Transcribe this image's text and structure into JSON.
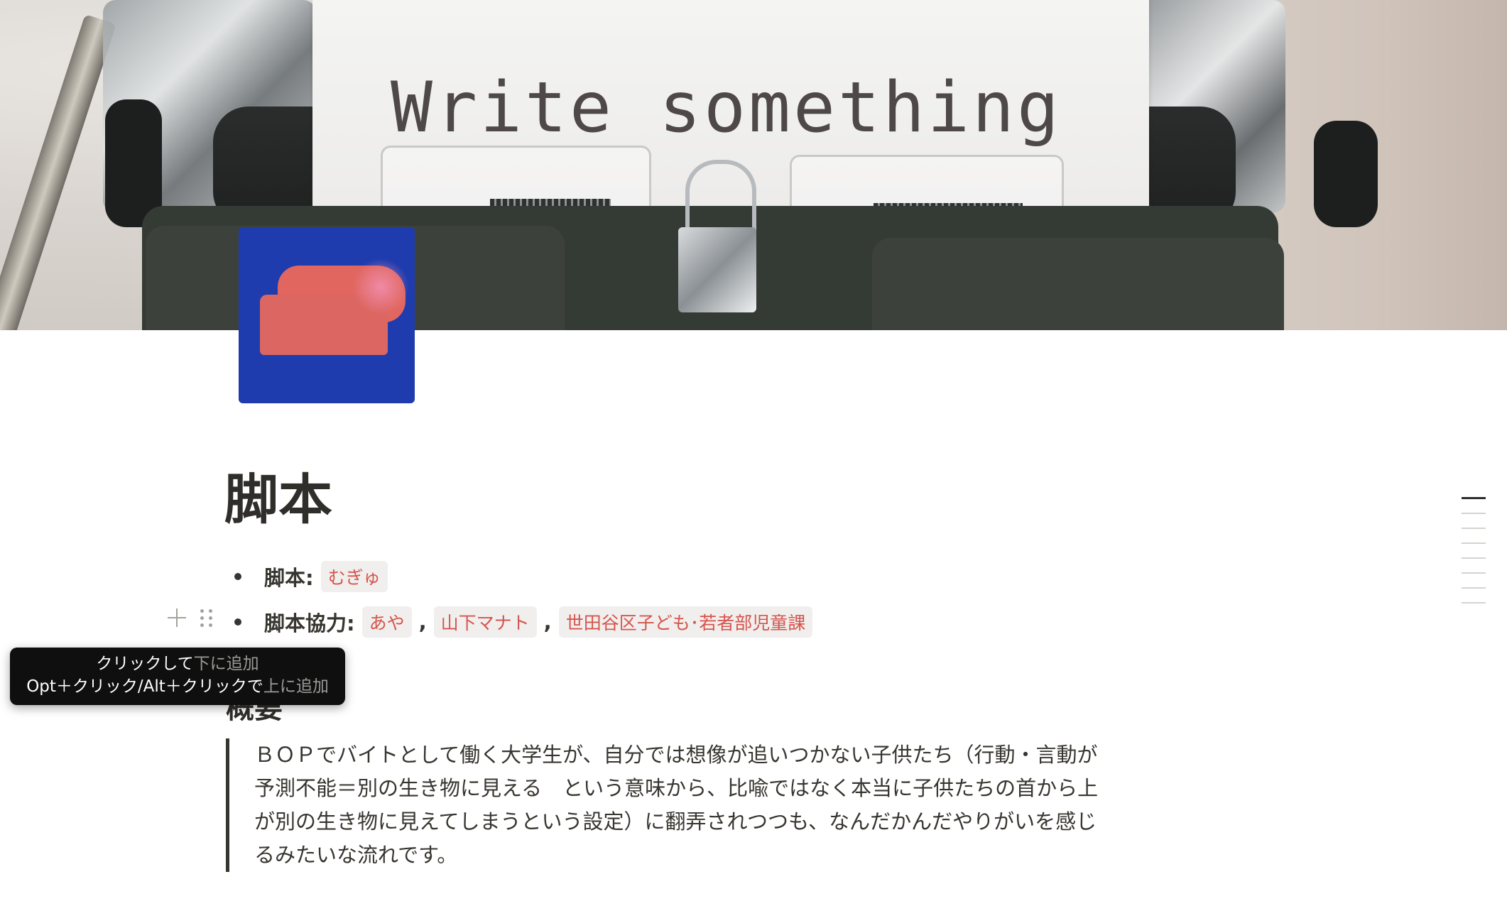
{
  "cover": {
    "paper_text": "Write something",
    "accent_colors": {
      "icon_background": "#1f3caf",
      "icon_shape": "#dc6661"
    }
  },
  "page": {
    "title": "脚本",
    "properties": [
      {
        "label": "脚本:",
        "tags": [
          "むぎゅ"
        ]
      },
      {
        "label": "脚本協力:",
        "tags": [
          "あや",
          "山下マナト",
          "世田谷区子ども･若者部児童課"
        ]
      }
    ],
    "tag_color": "#d6544e",
    "section_heading": "概要",
    "quote_lines": [
      "ＢＯＰでバイトとして働く大学生が、自分では想像が追いつかない子供たち（行動・言動が",
      "予測不能＝別の生き物に見える　という意味から、比喩ではなく本当に子供たちの首から上",
      "が別の生き物に見えてしまうという設定）に翻弄されつつも、なんだかんだやりがいを感じ",
      "るみたいな流れです。"
    ]
  },
  "tooltip": {
    "line1_bright": "クリックして",
    "line1_dim": "下に追加",
    "line2_bright": "Opt＋クリック/Alt＋クリックで",
    "line2_dim": "上に追加"
  },
  "block_handles": {
    "add_icon": "plus-icon",
    "drag_icon": "drag-handle-icon"
  },
  "toc": {
    "entries": 8,
    "active_index": 0
  }
}
